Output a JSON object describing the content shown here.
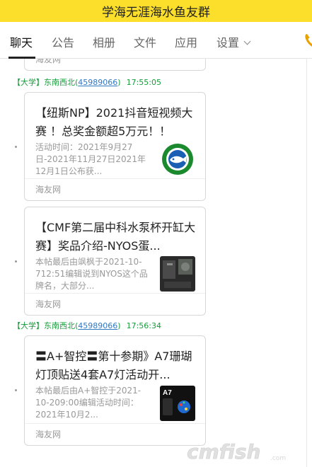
{
  "title": "学海无涯海水鱼友群",
  "tabs": [
    {
      "label": "聊天",
      "active": true
    },
    {
      "label": "公告",
      "active": false
    },
    {
      "label": "相册",
      "active": false
    },
    {
      "label": "文件",
      "active": false
    },
    {
      "label": "应用",
      "active": false
    },
    {
      "label": "设置",
      "active": false
    }
  ],
  "partial_card": {
    "source": "海友网"
  },
  "messages": [
    {
      "sender": {
        "prefix": "【大学】东南西北(",
        "qq": "45989066",
        "suffix": ")",
        "time": "17:55:05"
      },
      "cards": [
        {
          "title": "【纽斯NP】2021抖音短视频大赛 ！总奖金额超5万元！！",
          "desc": "活动时间：2021年9月27日-2021年11月27日2021年12月1日公布获...",
          "source": "海友网",
          "thumb_icon": "fish-club-logo-icon"
        },
        {
          "title": "【CMF第二届中科水泵杯开缸大赛】奖品介绍-NYOS蛋...",
          "desc": "本帖最后由飒枫于2021-10-712:51编辑说到NYOS这个品牌名，大部分...",
          "source": "海友网",
          "thumb_icon": "product-photo-icon"
        }
      ]
    },
    {
      "sender": {
        "prefix": "【大学】东南西北(",
        "qq": "45989066",
        "suffix": ")",
        "time": "17:56:34"
      },
      "cards": [
        {
          "title": "〓A+智控〓第十参期》A7珊瑚灯顶贴送4套A7灯活动开...",
          "desc": "本帖最后由A+智控于2021-10-209:00编辑活动时间：2021年10月2...",
          "source": "海友网",
          "thumb_icon": "a7-lamp-photo-icon"
        }
      ]
    }
  ],
  "watermark": "cmfish",
  "colors": {
    "titlebar": "#fcdf2a",
    "sender": "#169c3b",
    "qq_link": "#2f78c4",
    "phone_icon": "#e8a300"
  }
}
